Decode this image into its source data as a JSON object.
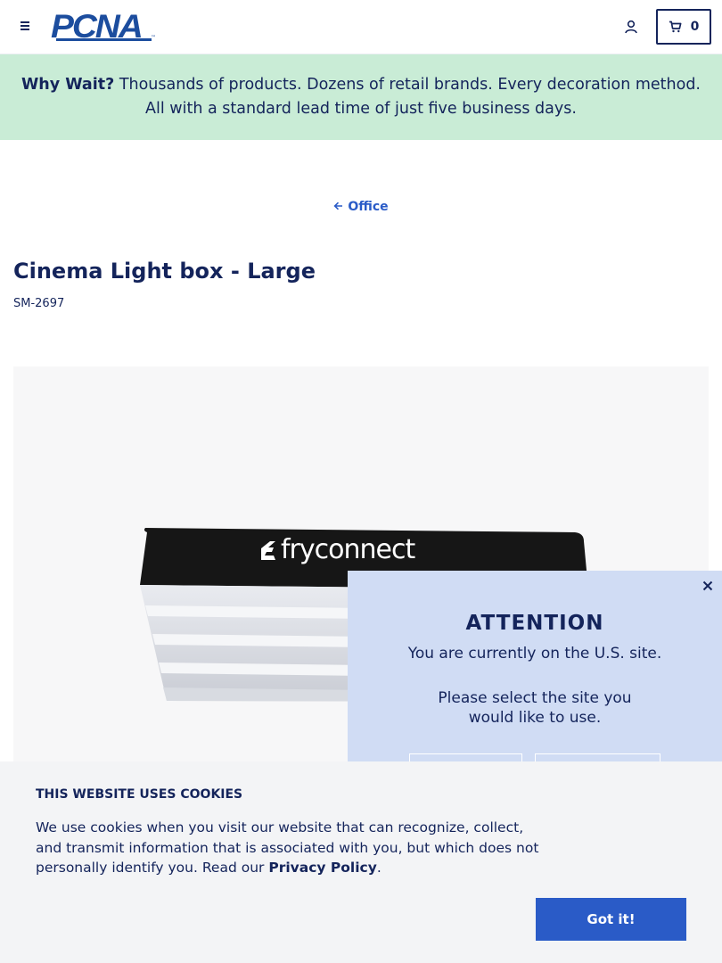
{
  "header": {
    "logo_text": "PCNA",
    "logo_tm": "™",
    "cart_count": "0"
  },
  "promo": {
    "lead": "Why Wait?",
    "text": " Thousands of products. Dozens of retail brands. Every decoration method. All with a standard lead time of just five business days."
  },
  "breadcrumb": {
    "back_label": "Office"
  },
  "product": {
    "title": "Cinema Light box - Large",
    "sku": "SM-2697",
    "image_brand_text": "fryconnect"
  },
  "region_modal": {
    "heading": "ATTENTION",
    "current_site": "You are currently on the U.S. site.",
    "prompt": "Please select the site you would like to use."
  },
  "cookie": {
    "title": "THIS WEBSITE USES COOKIES",
    "text": "We use cookies when you visit our website that can recognize, collect, and transmit information that is associated with you, but which does not personally identify you. Read our ",
    "link": "Privacy Policy",
    "period": ".",
    "button": "Got it!"
  },
  "colors": {
    "navy": "#14245b",
    "link_blue": "#2a5bc7",
    "promo_bg": "#c9ecd6",
    "modal_bg": "#d0dcf4",
    "cookie_bg": "#f3f4f6"
  }
}
